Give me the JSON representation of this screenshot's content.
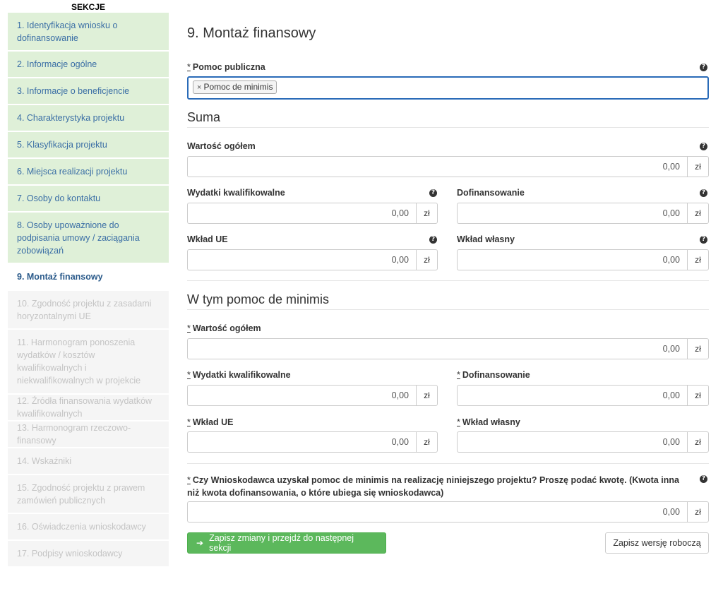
{
  "sidebar": {
    "header": "SEKCJE",
    "items": [
      {
        "label": "1. Identyfikacja wniosku o dofinansowanie",
        "state": "done"
      },
      {
        "label": "2. Informacje ogólne",
        "state": "done"
      },
      {
        "label": "3. Informacje o beneficjencie",
        "state": "done"
      },
      {
        "label": "4. Charakterystyka projektu",
        "state": "done"
      },
      {
        "label": "5. Klasyfikacja projektu",
        "state": "done"
      },
      {
        "label": "6. Miejsca realizacji projektu",
        "state": "done"
      },
      {
        "label": "7. Osoby do kontaktu",
        "state": "done"
      },
      {
        "label": "8. Osoby upoważnione do podpisania umowy / zaciągania zobowiązań",
        "state": "done"
      },
      {
        "label": "9. Montaż finansowy",
        "state": "active"
      },
      {
        "label": "10. Zgodność projektu z zasadami horyzontalnymi UE",
        "state": "todo"
      },
      {
        "label": "11. Harmonogram ponoszenia wydatków / kosztów kwalifikowalnych i niekwalifikowalnych w projekcie",
        "state": "todo"
      },
      {
        "label": "12. Źródła finansowania wydatków kwalifikowalnych",
        "state": "todo"
      },
      {
        "label": "13. Harmonogram rzeczowo-finansowy",
        "state": "todo"
      },
      {
        "label": "14. Wskaźniki",
        "state": "todo"
      },
      {
        "label": "15. Zgodność projektu z prawem zamówień publicznych",
        "state": "todo"
      },
      {
        "label": "16. Oświadczenia wnioskodawcy",
        "state": "todo"
      },
      {
        "label": "17. Podpisy wnioskodawcy",
        "state": "todo"
      }
    ]
  },
  "page": {
    "title": "9. Montaż finansowy",
    "required_mark": "*",
    "help_glyph": "?",
    "currency": "zł"
  },
  "pomoc": {
    "label": "Pomoc publiczna",
    "tag_remove": "×",
    "tag": "Pomoc de minimis"
  },
  "suma": {
    "title": "Suma",
    "wartosc_label": "Wartość ogółem",
    "wartosc_value": "0,00",
    "wydatki_label": "Wydatki kwalifikowalne",
    "wydatki_value": "0,00",
    "dofin_label": "Dofinansowanie",
    "dofin_value": "0,00",
    "ue_label": "Wkład UE",
    "ue_value": "0,00",
    "wlasny_label": "Wkład własny",
    "wlasny_value": "0,00"
  },
  "minimis": {
    "title": "W tym pomoc de minimis",
    "wartosc_label": "Wartość ogółem",
    "wartosc_value": "0,00",
    "wydatki_label": "Wydatki kwalifikowalne",
    "wydatki_value": "0,00",
    "dofin_label": "Dofinansowanie",
    "dofin_value": "0,00",
    "ue_label": "Wkład UE",
    "ue_value": "0,00",
    "wlasny_label": "Wkład własny",
    "wlasny_value": "0,00"
  },
  "question": {
    "line1": "Czy Wnioskodawca uzyskał pomoc de minimis na realizację niniejszego projektu? Proszę podać kwotę. (Kwota inna",
    "line2": "niż kwota dofinansowania, o które ubiega się wnioskodawca)",
    "value": "0,00"
  },
  "actions": {
    "arrow": "➔",
    "save_next": "Zapisz zmiany i przejdź do następnej sekcji",
    "save_draft": "Zapisz wersję roboczą"
  }
}
